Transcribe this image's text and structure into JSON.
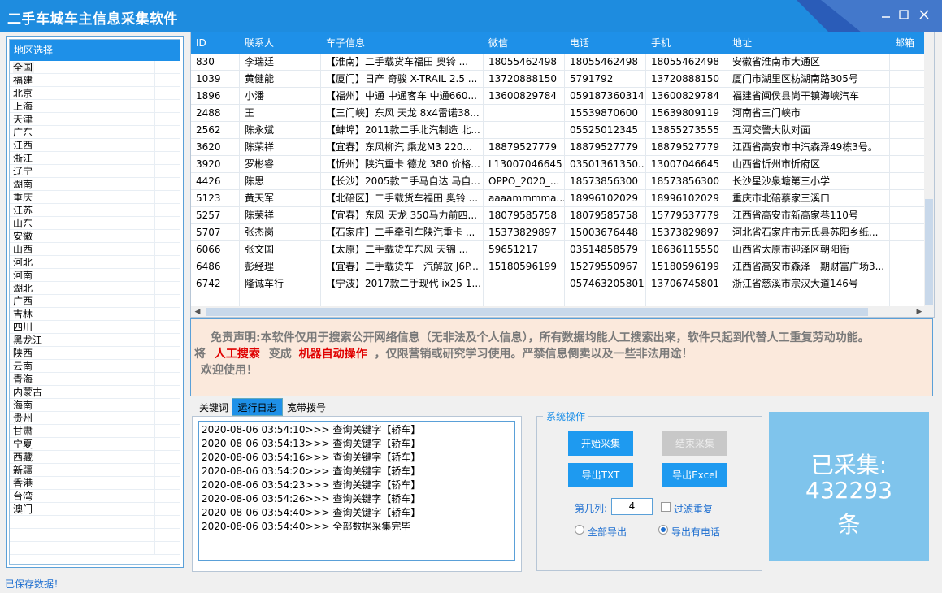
{
  "window": {
    "title": "二手车城车主信息采集软件",
    "controls": [
      "minimize-icon",
      "maximize-icon",
      "close-icon"
    ]
  },
  "region": {
    "header": "地区选择",
    "items": [
      "全国",
      "福建",
      "北京",
      "上海",
      "天津",
      "广东",
      "江西",
      "浙江",
      "辽宁",
      "湖南",
      "重庆",
      "江苏",
      "山东",
      "安徽",
      "山西",
      "河北",
      "河南",
      "湖北",
      "广西",
      "吉林",
      "四川",
      "黑龙江",
      "陕西",
      "云南",
      "青海",
      "内蒙古",
      "海南",
      "贵州",
      "甘肃",
      "宁夏",
      "西藏",
      "新疆",
      "香港",
      "台湾",
      "澳门"
    ]
  },
  "grid": {
    "columns": [
      "ID",
      "联系人",
      "车子信息",
      "微信",
      "电话",
      "手机",
      "地址",
      "邮箱"
    ],
    "rows": [
      [
        "830",
        "李瑞廷",
        "【淮南】二手载货车福田 奥铃 ...",
        "18055462498",
        "18055462498",
        "18055462498",
        "安徽省淮南市大通区",
        ""
      ],
      [
        "1039",
        "黄健能",
        "【厦门】日产 奇骏 X-TRAIL 2.5 ...",
        "13720888150",
        "5791792",
        "13720888150",
        "厦门市湖里区枋湖南路305号",
        ""
      ],
      [
        "1896",
        "小潘",
        "【福州】中通 中通客车 中通660...",
        "13600829784",
        "059187360314",
        "13600829784",
        "福建省闽侯县尚干镇海峡汽车",
        ""
      ],
      [
        "2488",
        "王",
        "【三门峡】东风 天龙 8x4雷诺38...",
        "",
        "15539870600",
        "15639809119",
        "河南省三门峡市",
        ""
      ],
      [
        "2562",
        "陈永斌",
        "【蚌埠】2011款二手北汽制造 北...",
        "",
        "05525012345",
        "13855273555",
        "五河交警大队对面",
        ""
      ],
      [
        "3620",
        "陈荣祥",
        "【宜春】东风柳汽 乘龙M3 220...",
        "18879527779",
        "18879527779",
        "18879527779",
        "江西省高安市中汽森泽49栋3号。",
        ""
      ],
      [
        "3920",
        "罗彬睿",
        "【忻州】陕汽重卡 德龙 380 价格...",
        "L13007046645",
        "03501361350...",
        "13007046645",
        "山西省忻州市忻府区",
        ""
      ],
      [
        "4426",
        "陈思",
        "【长沙】2005款二手马自达 马自...",
        "OPPO_2020_...",
        "18573856300",
        "18573856300",
        "长沙星沙泉塘第三小学",
        ""
      ],
      [
        "5123",
        "黄天军",
        "【北碚区】二手载货车福田 奥铃 ...",
        "aaaammmma...",
        "18996102029",
        "18996102029",
        "重庆市北碚蔡家三溪口",
        ""
      ],
      [
        "5257",
        "陈荣祥",
        "【宜春】东风 天龙 350马力前四...",
        "18079585758",
        "18079585758",
        "15779537779",
        "江西省高安市新高家巷110号",
        ""
      ],
      [
        "5707",
        "张杰岗",
        "【石家庄】二手牵引车陕汽重卡 ...",
        "15373829897",
        "15003676448",
        "15373829897",
        "河北省石家庄市元氏县苏阳乡纸...",
        ""
      ],
      [
        "6066",
        "张文国",
        "【太原】二手载货车东风 天锦 ...",
        "59651217",
        "03514858579",
        "18636115550",
        "山西省太原市迎泽区朝阳街",
        ""
      ],
      [
        "6486",
        "彭经理",
        "【宜春】二手载货车一汽解放 J6P...",
        "15180596199",
        "15279550967",
        "15180596199",
        "江西省高安市森泽一期财富广场3...",
        ""
      ],
      [
        "6742",
        "隆诚车行",
        "【宁波】2017款二手现代 ix25 1...",
        "",
        "057463205801",
        "13706745801",
        "浙江省慈溪市宗汉大道146号",
        ""
      ]
    ]
  },
  "disclaimer": {
    "line1": "免责声明:本软件仅用于搜索公开网络信息（无非法及个人信息），所有数据均能人工搜索出来，软件只起到代替人工重复劳动功能。",
    "line2_pre": "将",
    "line2_red1": "人工搜索",
    "line2_mid": "变成",
    "line2_red2": "机器自动操作",
    "line2_post": "，仅限营销或研究学习使用。严禁信息倒卖以及一些非法用途！",
    "line3": "欢迎使用！"
  },
  "tabs": [
    "关键词",
    "运行日志",
    "宽带拨号"
  ],
  "log": [
    "2020-08-06 03:54:10>>> 查询关键字【轿车】",
    "2020-08-06 03:54:13>>> 查询关键字【轿车】",
    "2020-08-06 03:54:16>>> 查询关键字【轿车】",
    "2020-08-06 03:54:20>>> 查询关键字【轿车】",
    "2020-08-06 03:54:23>>> 查询关键字【轿车】",
    "2020-08-06 03:54:26>>> 查询关键字【轿车】",
    "2020-08-06 03:54:40>>> 查询关键字【轿车】",
    "2020-08-06 03:54:40>>> 全部数据采集完毕"
  ],
  "ops": {
    "legend": "系统操作",
    "start": "开始采集",
    "stop": "结束采集",
    "export_txt": "导出TXT",
    "export_excel": "导出Excel",
    "col_label": "第几列:",
    "col_value": "4",
    "filter_dup": "过滤重复",
    "export_all": "全部导出",
    "export_phone": "导出有电话",
    "selected_export": "export_phone"
  },
  "counter": {
    "label": "已采集:",
    "count": "432293",
    "unit": "条"
  },
  "status": {
    "text": "已保存数据！"
  },
  "colors": {
    "accent": "#1e90e8",
    "title_bar": "#1e8cdf",
    "counter_bg": "#7fc4ec",
    "disclaimer_bg": "#fbe9dc",
    "highlight_red": "#e00000"
  }
}
